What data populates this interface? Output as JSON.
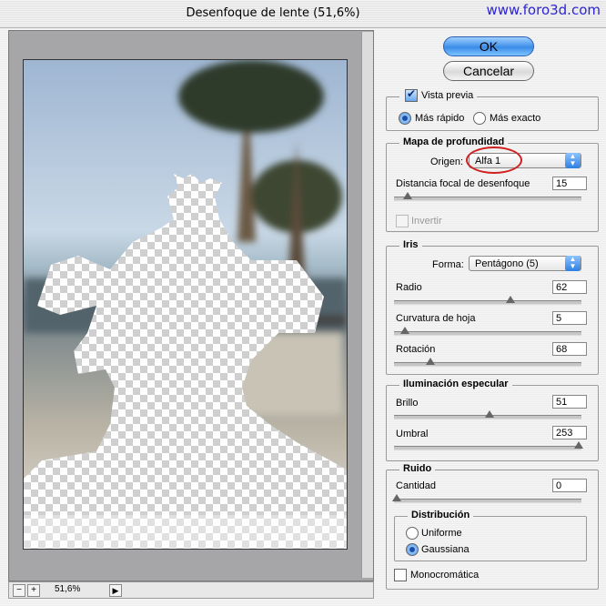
{
  "window": {
    "title": "Desenfoque de lente (51,6%)",
    "watermark": "www.foro3d.com"
  },
  "preview": {
    "zoom": "51,6%",
    "zoom_out": "−",
    "zoom_in": "+"
  },
  "buttons": {
    "ok": "OK",
    "cancel": "Cancelar"
  },
  "preview_group": {
    "legend": "Vista previa",
    "checked": true,
    "fast": "Más rápido",
    "exact": "Más exacto",
    "selected": "fast"
  },
  "depth_map": {
    "legend": "Mapa de profundidad",
    "source_label": "Origen:",
    "source_value": "Alfa 1",
    "focal_label": "Distancia focal de desenfoque",
    "focal_value": "15",
    "invert_label": "Invertir"
  },
  "iris": {
    "legend": "Iris",
    "shape_label": "Forma:",
    "shape_value": "Pentágono (5)",
    "radius_label": "Radio",
    "radius_value": "62",
    "curvature_label": "Curvatura de hoja",
    "curvature_value": "5",
    "rotation_label": "Rotación",
    "rotation_value": "68"
  },
  "specular": {
    "legend": "Iluminación especular",
    "brightness_label": "Brillo",
    "brightness_value": "51",
    "threshold_label": "Umbral",
    "threshold_value": "253"
  },
  "noise": {
    "legend": "Ruido",
    "amount_label": "Cantidad",
    "amount_value": "0",
    "distribution_legend": "Distribución",
    "uniform": "Uniforme",
    "gaussian": "Gaussiana",
    "selected": "gaussian",
    "mono_label": "Monocromática"
  },
  "colors": {
    "accent": "#3b8ce8",
    "highlight": "#d02020",
    "watermark": "#2c24d6"
  }
}
